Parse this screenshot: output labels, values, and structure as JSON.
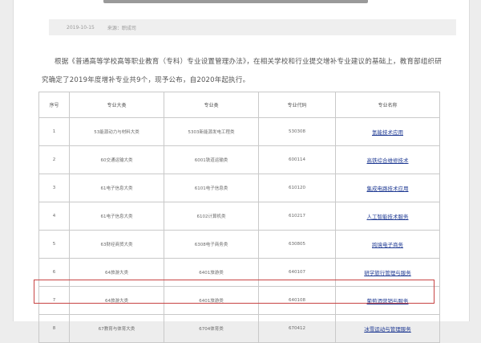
{
  "meta": {
    "date": "2019-10-15",
    "source_label": "来源：",
    "source": "职成司"
  },
  "intro_text": "根据《普通高等学校高等职业教育（专科）专业设置管理办法》，在相关学校和行业提交增补专业建议的基础上，教育部组织研究确定了2019年度增补专业共9个，现予公布，自2020年起执行。",
  "table": {
    "headers": [
      "序号",
      "专业大类",
      "专业类",
      "专业代码",
      "专业名称"
    ],
    "rows": [
      [
        "1",
        "53能源动力与材料大类",
        "5303新能源发电工程类",
        "530308",
        "氢能技术应用"
      ],
      [
        "2",
        "60交通运输大类",
        "6001铁道运输类",
        "600114",
        "高铁综合维修技术"
      ],
      [
        "3",
        "61电子信息大类",
        "6101电子信息类",
        "610120",
        "集成电路技术应用"
      ],
      [
        "4",
        "61电子信息大类",
        "6102计算机类",
        "610217",
        "人工智能技术服务"
      ],
      [
        "5",
        "63财经商贸大类",
        "6308电子商务类",
        "630805",
        "跨境电子商务"
      ],
      [
        "6",
        "64旅游大类",
        "6401旅游类",
        "640107",
        "研学旅行管理与服务"
      ],
      [
        "7",
        "64旅游大类",
        "6401旅游类",
        "640108",
        "葡萄酒营销与服务"
      ],
      [
        "8",
        "67教育与体育大类",
        "6704体育类",
        "670412",
        "冰雪运动与管理服务"
      ]
    ]
  }
}
